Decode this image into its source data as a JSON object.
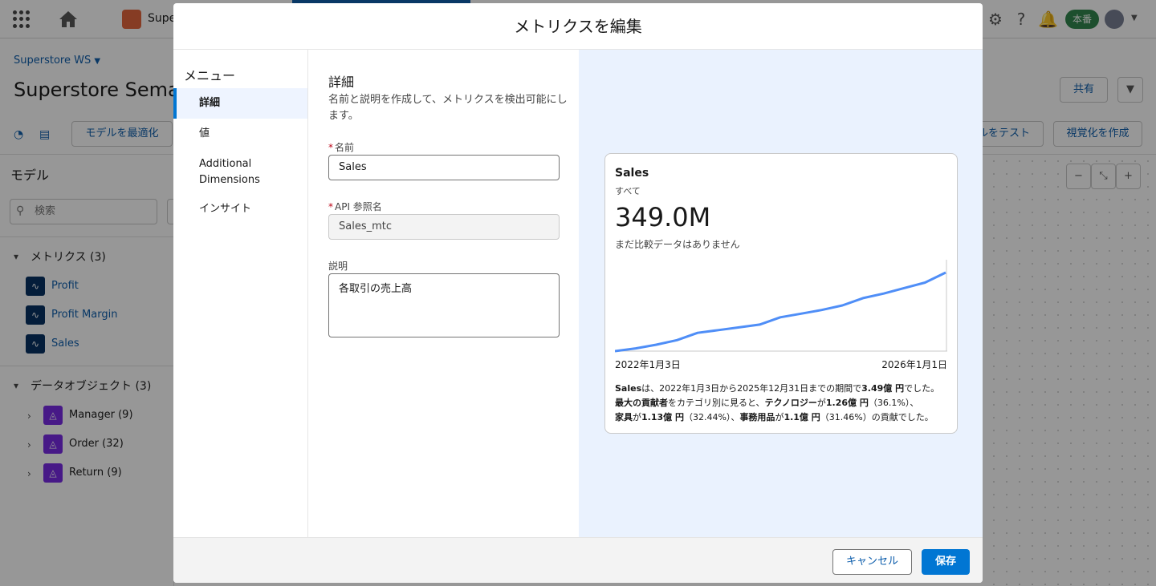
{
  "header": {
    "app_name": "Super",
    "env_badge": "本番"
  },
  "page": {
    "breadcrumb": "Superstore WS",
    "title": "Superstore Semantic"
  },
  "toolbar": {
    "optimize_label": "モデルを最適化",
    "share_label": "共有",
    "test_label": "ルをテスト",
    "visualize_label": "視覚化を作成"
  },
  "sidebar": {
    "model_heading": "モデル",
    "search_placeholder": "検索",
    "metrics_heading": "メトリクス (3)",
    "metrics": [
      "Profit",
      "Profit Margin",
      "Sales"
    ],
    "data_heading": "データオブジェクト (3)",
    "data_objects": [
      "Manager (9)",
      "Order (32)",
      "Return (9)"
    ]
  },
  "modal": {
    "title": "メトリクスを編集",
    "menu_heading": "メニュー",
    "menu": [
      "詳細",
      "値",
      "Additional Dimensions",
      "インサイト"
    ],
    "form": {
      "heading": "詳細",
      "description": "名前と説明を作成して、メトリクスを検出可能にします。",
      "name_label": "名前",
      "name_value": "Sales",
      "api_label": "API 参照名",
      "api_value": "Sales_mtc",
      "desc_label": "説明",
      "desc_value": "各取引の売上高"
    },
    "preview": {
      "title": "Sales",
      "subtitle": "すべて",
      "value": "349.0M",
      "comparison": "まだ比較データはありません",
      "x_start": "2022年1月3日",
      "x_end": "2026年1月1日",
      "summary": {
        "s1": "Sales",
        "s2": "は、2022年1月3日から2025年12月31日までの期間で",
        "s3": "3.49億 円",
        "s4": "でした。",
        "s5": "最大の貢献者",
        "s6": "をカテゴリ別に見ると、",
        "s7": "テクノロジー",
        "s8": "が",
        "s9": "1.26億 円",
        "s10": "（36.1%）、",
        "s11": "家具",
        "s12": "が",
        "s13": "1.13億 円",
        "s14": "（32.44%）、",
        "s15": "事務用品",
        "s16": "が",
        "s17": "1.1億 円",
        "s18": "（31.46%）",
        "s19": "の貢献でした。"
      }
    },
    "cancel_label": "キャンセル",
    "save_label": "保存"
  },
  "chart_data": {
    "type": "line",
    "x": [
      "2022-01-03",
      "2022-04",
      "2022-07",
      "2022-10",
      "2023-01",
      "2023-04",
      "2023-07",
      "2023-10",
      "2024-01",
      "2024-04",
      "2024-07",
      "2024-10",
      "2025-01",
      "2025-04",
      "2025-07",
      "2025-10",
      "2025-12-31"
    ],
    "series": [
      {
        "values": [
          0.0,
          3,
          7,
          12,
          20,
          23,
          26,
          29,
          37,
          41,
          45,
          50,
          58,
          63,
          69,
          75,
          86
        ]
      }
    ],
    "color": "#4f8ef7",
    "ylim": [
      0,
      100
    ]
  }
}
